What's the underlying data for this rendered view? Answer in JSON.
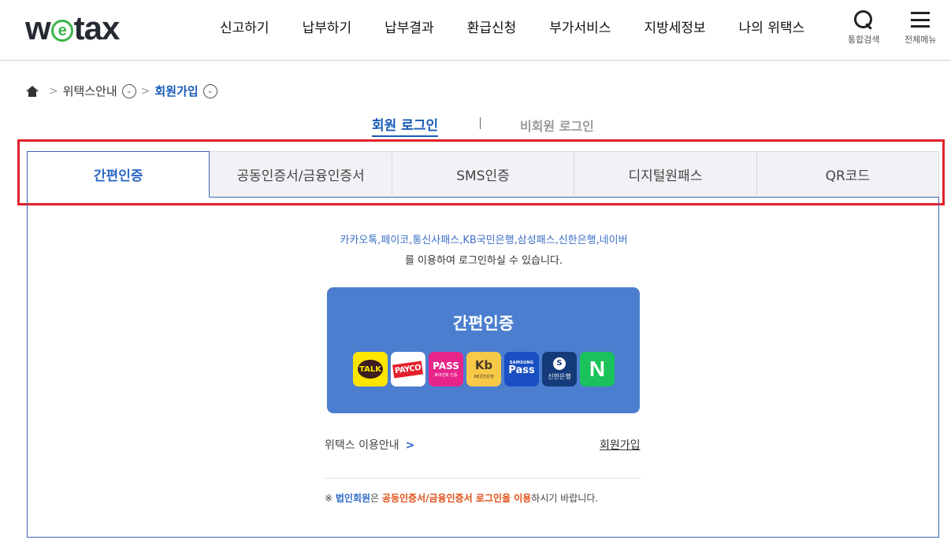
{
  "header": {
    "logo": {
      "pre": "w",
      "mid": "e",
      "post": "tax"
    },
    "nav": [
      "신고하기",
      "납부하기",
      "납부결과",
      "환급신청",
      "부가서비스",
      "지방세정보",
      "나의 위택스"
    ],
    "search_label": "통합검색",
    "menu_label": "전체메뉴"
  },
  "breadcrumb": {
    "items": [
      "위택스안내",
      "회원가입"
    ],
    "separator": ">",
    "chevron": "⌄"
  },
  "login_switch": {
    "member": "회원 로그인",
    "guest": "비회원 로그인"
  },
  "tabs": [
    "간편인증",
    "공동인증서/금융인증서",
    "SMS인증",
    "디지털원패스",
    "QR코드"
  ],
  "panel": {
    "providers_text": "카카오톡,페이코,통신사패스,KB국민은행,삼성패스,신한은행,네이버",
    "providers_suffix": "를 이용하여 로그인하실 수 있습니다.",
    "card_title": "간편인증",
    "providers": {
      "kakao": "TALK",
      "payco": "PAYCO",
      "pass": "PASS",
      "pass_sub": "휴대전화 인증",
      "kb": "Kb",
      "kb_sub": "KB국민은행",
      "samsung_top": "SAMSUNG",
      "samsung": "Pass",
      "shinhan_mark": "S",
      "shinhan": "신한은행",
      "naver": "N"
    },
    "guide_link": "위택스 이용안내",
    "guide_chevron": ">",
    "join_link": "회원가입",
    "notice": {
      "prefix": "※ ",
      "corp": "법인회원",
      "mid1": "은 ",
      "emph": "공동인증서/금융인증서 로그인을 이용",
      "suffix": "하시기 바랍니다."
    }
  },
  "colors": {
    "accent": "#2e6ac7",
    "highlight_box": "#e2202a",
    "card_bg": "#4b7ecf",
    "notice_emph": "#e04e16"
  }
}
